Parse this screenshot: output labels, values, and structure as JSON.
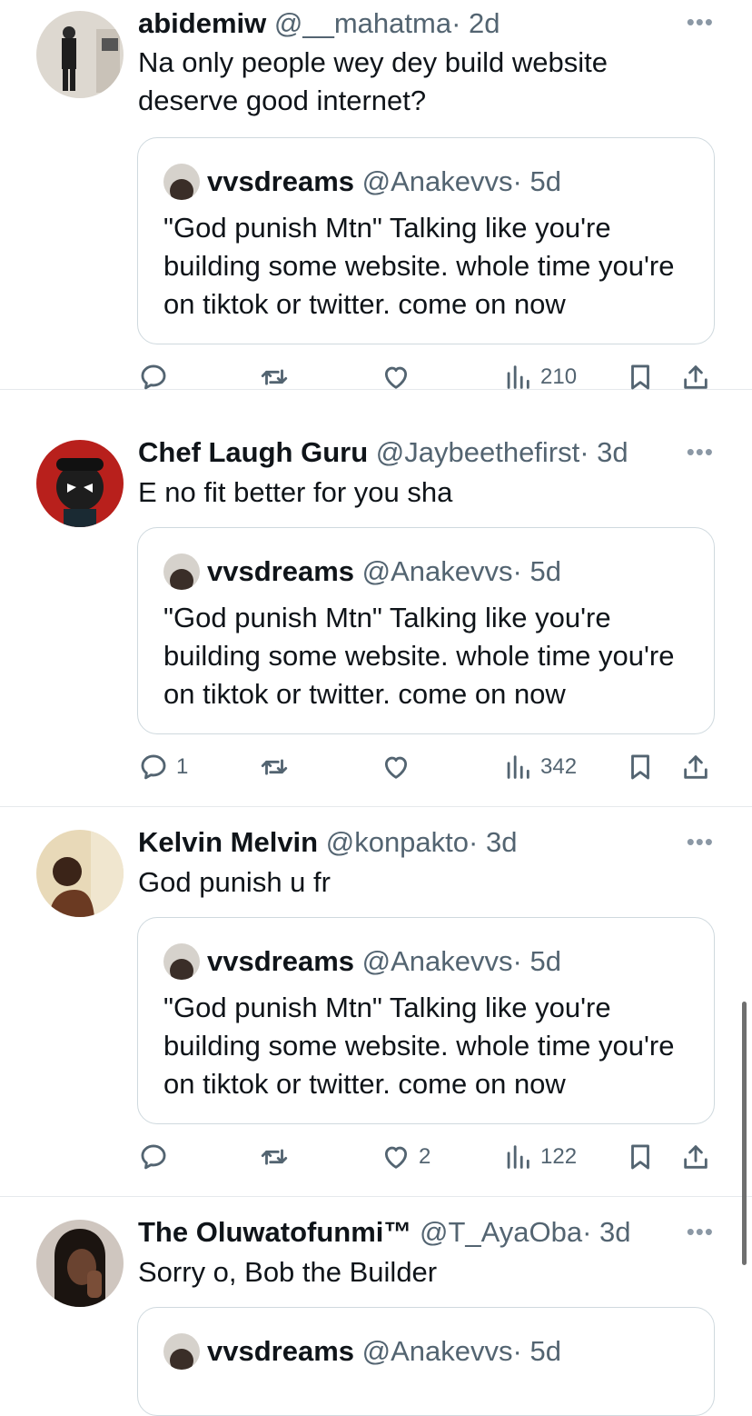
{
  "tweets": [
    {
      "name": "abidemiw",
      "handle": "@__mahatma",
      "time": "· 2d",
      "text": "Na only people wey dey build website deserve good internet?",
      "quote": {
        "name": "vvsdreams",
        "handle": "@Anakevvs",
        "time": "· 5d",
        "text": "\"God punish Mtn\" Talking like you're building some website. whole time you're on tiktok or twitter. come on now"
      },
      "replies": "",
      "likes": "",
      "views": "210"
    },
    {
      "name": "Chef Laugh Guru",
      "handle": "@Jaybeethefirst",
      "time": "· 3d",
      "text": "E no fit better for you sha",
      "quote": {
        "name": "vvsdreams",
        "handle": "@Anakevvs",
        "time": "· 5d",
        "text": "\"God punish Mtn\" Talking like you're building some website. whole time you're on tiktok or twitter. come on now"
      },
      "replies": "1",
      "likes": "",
      "views": "342"
    },
    {
      "name": "Kelvin Melvin",
      "handle": "@konpakto",
      "time": "· 3d",
      "text": "God punish u fr",
      "quote": {
        "name": "vvsdreams",
        "handle": "@Anakevvs",
        "time": "· 5d",
        "text": "\"God punish Mtn\" Talking like you're building some website. whole time you're on tiktok or twitter. come on now"
      },
      "replies": "",
      "likes": "2",
      "views": "122"
    },
    {
      "name": "The Oluwatofunmi™",
      "handle": "@T_AyaOba",
      "time": "· 3d",
      "text": "Sorry o, Bob the Builder",
      "quote": {
        "name": "vvsdreams",
        "handle": "@Anakevvs",
        "time": "· 5d"
      }
    }
  ],
  "icons": {
    "more": "more-dots-icon",
    "reply": "reply-bubble-icon",
    "retweet": "retweet-icon",
    "like": "heart-icon",
    "views": "views-bar-chart-icon",
    "bookmark": "bookmark-icon",
    "share": "share-upload-icon"
  }
}
